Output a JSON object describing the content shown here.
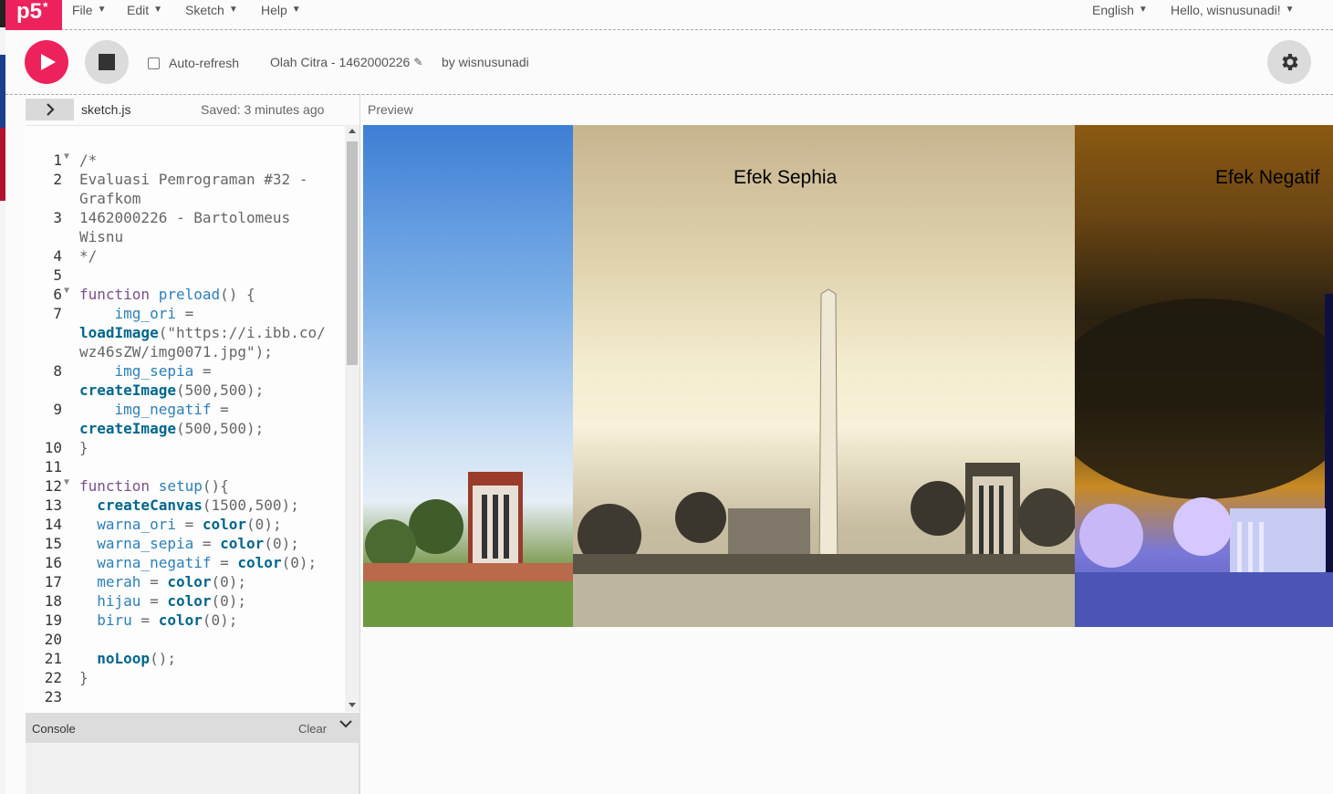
{
  "nav": {
    "logo": "p5",
    "logo_sup": "*",
    "menus": [
      "File",
      "Edit",
      "Sketch",
      "Help"
    ],
    "language": "English",
    "greeting": "Hello, wisnusunadi!"
  },
  "toolbar": {
    "auto_refresh_label": "Auto-refresh",
    "auto_refresh_checked": false,
    "project_name": "Olah Citra - 1462000226",
    "byline": "by wisnusunadi"
  },
  "editor": {
    "file_name": "sketch.js",
    "saved_status": "Saved: 3 minutes ago",
    "preview_label": "Preview",
    "lines": [
      {
        "n": "1",
        "fold": true
      },
      {
        "n": "2"
      },
      {
        "n": ""
      },
      {
        "n": "3"
      },
      {
        "n": ""
      },
      {
        "n": "4"
      },
      {
        "n": "5"
      },
      {
        "n": "6",
        "fold": true
      },
      {
        "n": "7"
      },
      {
        "n": ""
      },
      {
        "n": ""
      },
      {
        "n": "8"
      },
      {
        "n": ""
      },
      {
        "n": "9"
      },
      {
        "n": ""
      },
      {
        "n": "10"
      },
      {
        "n": "11"
      },
      {
        "n": "12",
        "fold": true
      },
      {
        "n": "13"
      },
      {
        "n": "14"
      },
      {
        "n": "15"
      },
      {
        "n": "16"
      },
      {
        "n": "17"
      },
      {
        "n": "18"
      },
      {
        "n": "19"
      },
      {
        "n": "20"
      },
      {
        "n": "21"
      },
      {
        "n": "22"
      },
      {
        "n": "23"
      }
    ],
    "code": [
      "/*",
      "Evaluasi Pemrograman #32 -",
      "Grafkom",
      "1462000226 - Bartolomeus",
      "Wisnu",
      "*/",
      "",
      "function preload() {",
      "    img_ori =",
      "loadImage(\"https://i.ibb.co/",
      "wz46sZW/img0071.jpg\");",
      "    img_sepia =",
      "createImage(500,500);",
      "    img_negatif =",
      "createImage(500,500);",
      "}",
      "",
      "function setup(){",
      "  createCanvas(1500,500);",
      "  warna_ori = color(0);",
      "  warna_sepia = color(0);",
      "  warna_negatif = color(0);",
      "  merah = color(0);",
      "  hijau = color(0);",
      "  biru = color(0);",
      "",
      "  noLoop();",
      "}",
      ""
    ]
  },
  "console": {
    "title": "Console",
    "clear_label": "Clear"
  },
  "preview": {
    "sepia_title": "Efek Sephia",
    "negative_title": "Efek Negatif"
  },
  "colors": {
    "accent": "#ed225d",
    "button_gray": "#dbdbdb"
  },
  "icons": [
    "play-icon",
    "stop-icon",
    "gear-icon",
    "chevron-right-icon",
    "chevron-down-icon",
    "pencil-icon"
  ]
}
